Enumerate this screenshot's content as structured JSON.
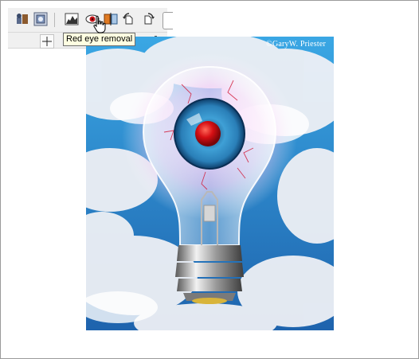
{
  "tooltip": {
    "text": "Red eye removal"
  },
  "photo": {
    "copyright": "©GaryW. Priester"
  },
  "toolbar": {
    "buttons": [
      {
        "name": "transform-icon"
      },
      {
        "name": "bitmap-mask-icon"
      },
      {
        "name": "histogram-icon"
      },
      {
        "name": "red-eye-icon"
      },
      {
        "name": "mirror-icon"
      },
      {
        "name": "rotate-left-icon"
      },
      {
        "name": "rotate-right-icon"
      }
    ]
  },
  "colors": {
    "sky": "#2f86c9",
    "cloud": "#eef0f5",
    "iris": "#2a7fb8",
    "pupil": "#d60f14",
    "glow": "#e8a0ee"
  }
}
